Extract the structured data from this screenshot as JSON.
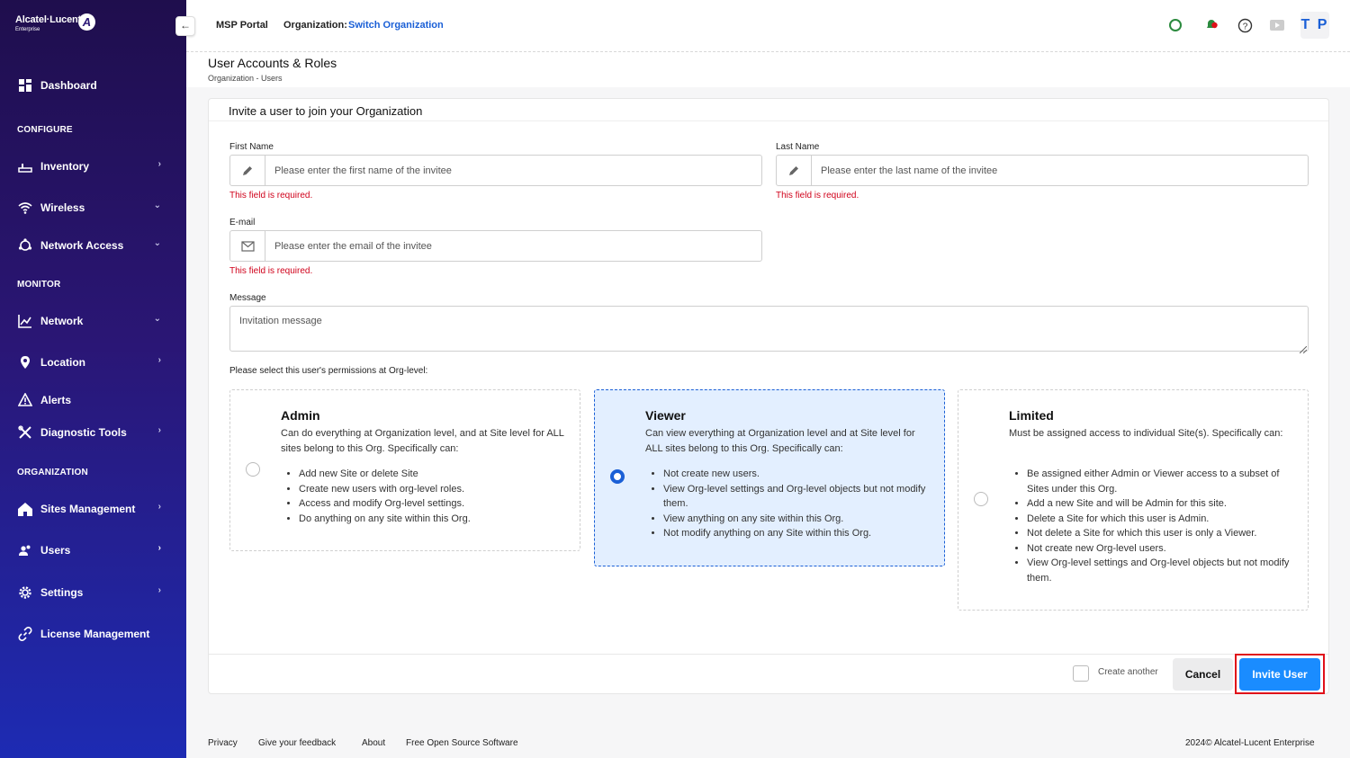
{
  "brand": {
    "name": "Alcatel·Lucent",
    "sub": "Enterprise"
  },
  "sidebar": {
    "dashboard": "Dashboard",
    "sections": {
      "configure": "CONFIGURE",
      "monitor": "MONITOR",
      "organization": "ORGANIZATION"
    },
    "items": {
      "inventory": "Inventory",
      "wireless": "Wireless",
      "network_access": "Network Access",
      "network": "Network",
      "location": "Location",
      "alerts": "Alerts",
      "diagnostic_tools": "Diagnostic Tools",
      "sites_management": "Sites Management",
      "users": "Users",
      "settings": "Settings",
      "license_management": "License Management"
    }
  },
  "topbar": {
    "msp_portal": "MSP Portal",
    "organization_label": "Organization:",
    "switch_org": "Switch Organization",
    "avatar": "T P"
  },
  "page": {
    "title": "User Accounts & Roles",
    "breadcrumb": "Organization  -  Users"
  },
  "form": {
    "card_title": "Invite a user to join your Organization",
    "first_name": {
      "label": "First Name",
      "placeholder": "Please enter the first name of the invitee",
      "value": "",
      "error": "This field is required."
    },
    "last_name": {
      "label": "Last Name",
      "placeholder": "Please enter the last name of the invitee",
      "value": "",
      "error": "This field is required."
    },
    "email": {
      "label": "E-mail",
      "placeholder": "Please enter the email of the invitee",
      "value": "",
      "error": "This field is required."
    },
    "message": {
      "label": "Message",
      "placeholder": "Invitation message",
      "value": ""
    },
    "permissions_label": "Please select this user's permissions at Org-level:",
    "permissions": {
      "selected": "Viewer",
      "admin": {
        "title": "Admin",
        "desc": "Can do everything at Organization level, and at Site level for ALL sites belong to this Org. Specifically can:",
        "items": [
          "Add new Site or delete Site",
          "Create new users with org-level roles.",
          "Access and modify Org-level settings.",
          "Do anything on any site within this Org."
        ]
      },
      "viewer": {
        "title": "Viewer",
        "desc": "Can view everything at Organization level and at Site level for ALL sites belong to this Org. Specifically can:",
        "items": [
          "Not create new users.",
          "View Org-level settings and Org-level objects but not modify them.",
          "View anything on any site within this Org.",
          "Not modify anything on any Site within this Org."
        ]
      },
      "limited": {
        "title": "Limited",
        "desc": "Must be assigned access to individual Site(s). Specifically can:",
        "items": [
          "Be assigned either Admin or Viewer access to a subset of Sites under this Org.",
          "Add a new Site and will be Admin for this site.",
          "Delete a Site for which this user is Admin.",
          "Not delete a Site for which this user is only a Viewer.",
          "Not create new Org-level users.",
          "View Org-level settings and Org-level objects but not modify them."
        ]
      }
    },
    "create_another": "Create another",
    "cancel": "Cancel",
    "invite": "Invite User"
  },
  "footer": {
    "privacy": "Privacy",
    "feedback": "Give your feedback",
    "about": "About",
    "oss": "Free Open Source Software",
    "copyright": "2024© Alcatel-Lucent Enterprise"
  },
  "colors": {
    "accent": "#1a5fd6",
    "primary_button": "#1a8cff",
    "error": "#d0021b",
    "highlight": "#e0101a"
  }
}
